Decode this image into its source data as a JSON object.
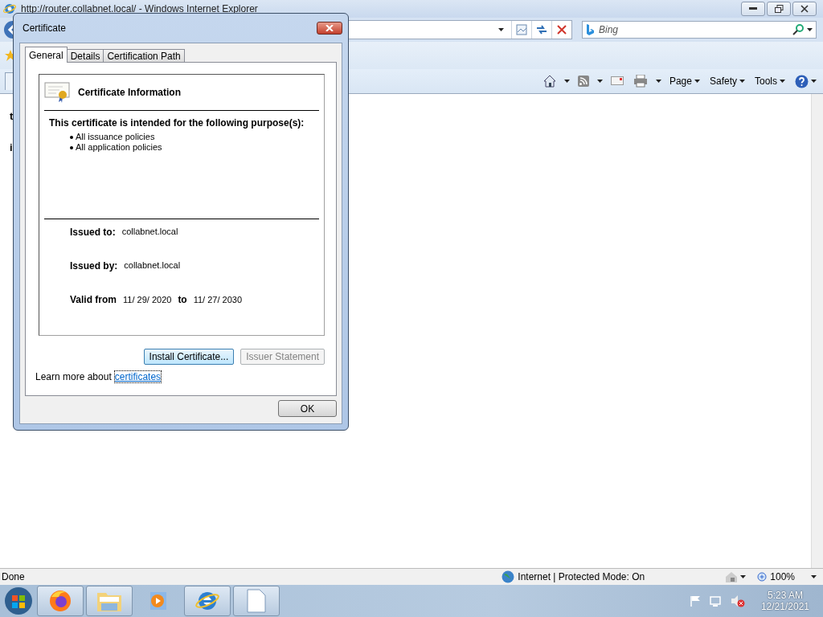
{
  "browser": {
    "title": "http://router.collabnet.local/ - Windows Internet Explorer",
    "search": {
      "placeholder": "Bing"
    },
    "command_bar": [
      {
        "label": "Page"
      },
      {
        "label": "Safety"
      },
      {
        "label": "Tools"
      }
    ],
    "page_fragments": [
      {
        "text": "t",
        "kind": "heading"
      },
      {
        "text": "i",
        "kind": "heading"
      }
    ],
    "status_bar": {
      "text": "Done",
      "zone": "Internet | Protected Mode: On",
      "zoom": "100%"
    }
  },
  "dialog": {
    "title": "Certificate",
    "tabs": [
      {
        "label": "General",
        "selected": true
      },
      {
        "label": "Details",
        "selected": false
      },
      {
        "label": "Certification Path",
        "selected": false
      }
    ],
    "heading": "Certificate Information",
    "purpose_title": "This certificate is intended for the following purpose(s):",
    "purposes": [
      "All issuance policies",
      "All application policies"
    ],
    "fields": [
      {
        "label": "Issued to:",
        "value": "collabnet.local"
      },
      {
        "label": "Issued by:",
        "value": "collabnet.local"
      }
    ],
    "valid": {
      "label": "Valid from",
      "from": "11/ 29/ 2020",
      "joiner": "to",
      "to": "11/ 27/ 2030"
    },
    "buttons": [
      {
        "label": "Install Certificate...",
        "disabled": false
      },
      {
        "label": "Issuer Statement",
        "disabled": true
      }
    ],
    "learn_more": {
      "text": "Learn more about",
      "link": "certificates"
    },
    "ok": "OK"
  },
  "taskbar": {
    "apps": [
      {
        "kind": "firefox",
        "running": true
      },
      {
        "kind": "folder",
        "running": true
      },
      {
        "kind": "media",
        "running": false
      },
      {
        "kind": "ie",
        "running": true
      },
      {
        "kind": "document",
        "running": true
      }
    ],
    "time": "5:23 AM",
    "date": "12/21/2021"
  }
}
